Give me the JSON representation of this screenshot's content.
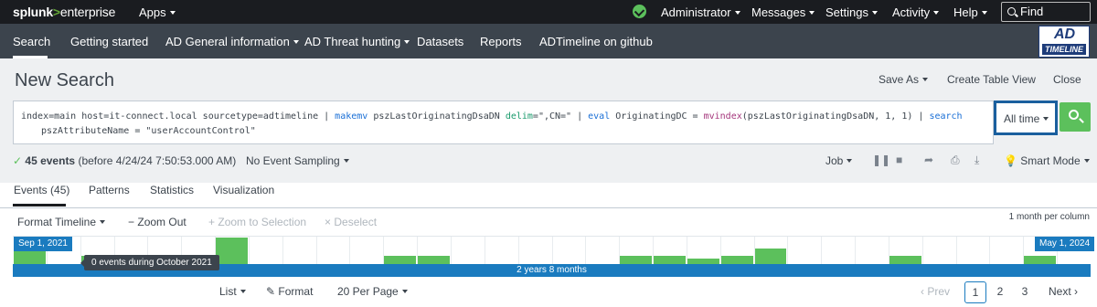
{
  "top_bar": {
    "logo": {
      "brand": "splunk",
      "arrow": ">",
      "product": "enterprise"
    },
    "apps_label": "Apps",
    "user_label": "Administrator",
    "messages_label": "Messages",
    "settings_label": "Settings",
    "activity_label": "Activity",
    "help_label": "Help",
    "find_placeholder": "Find"
  },
  "app_bar": {
    "nav_items": [
      "Search",
      "Getting started",
      "AD General information",
      "AD Threat hunting",
      "Datasets",
      "Reports",
      "ADTimeline on github"
    ],
    "logo": {
      "top": "AD",
      "bottom": "TIMELINE"
    }
  },
  "search": {
    "title": "New Search",
    "actions": {
      "save_as": "Save As",
      "create_table_view": "Create Table View",
      "close": "Close"
    },
    "query": {
      "line1": [
        {
          "t": "index=main host=it-connect.local sourcetype=adtimeline | ",
          "c": "text"
        },
        {
          "t": "makemv",
          "c": "kw"
        },
        {
          "t": " pszLastOriginatingDsaDN ",
          "c": "text"
        },
        {
          "t": "delim",
          "c": "arg"
        },
        {
          "t": "=\",CN=\" | ",
          "c": "text"
        },
        {
          "t": "eval",
          "c": "kw"
        },
        {
          "t": " OriginatingDC = ",
          "c": "text"
        },
        {
          "t": "mvindex",
          "c": "fn"
        },
        {
          "t": "(pszLastOriginatingDsaDN, 1, 1) |  ",
          "c": "text"
        },
        {
          "t": "search",
          "c": "kw"
        }
      ],
      "line2": "pszAttributeName = \"userAccountControl\""
    },
    "time_range": "All time",
    "events_count": "45 events",
    "events_before": "(before 4/24/24 7:50:53.000 AM)",
    "sampling": "No Event Sampling",
    "job_label": "Job",
    "mode": "Smart Mode"
  },
  "tabs": [
    "Events (45)",
    "Patterns",
    "Statistics",
    "Visualization"
  ],
  "timeline": {
    "format_label": "Format Timeline",
    "zoom_out": "Zoom Out",
    "zoom_selection": "Zoom to Selection",
    "deselect": "Deselect",
    "scale": "1 month per column",
    "start_label": "Sep 1, 2021",
    "end_label": "May 1, 2024",
    "span_label": "2 years 8 months",
    "tooltip": "0 events during October 2021",
    "columns": 32,
    "bars": [
      {
        "col": 0,
        "h": 0.55
      },
      {
        "col": 2,
        "h": 0.3
      },
      {
        "col": 3,
        "h": 0.3
      },
      {
        "col": 6,
        "h": 0.95
      },
      {
        "col": 11,
        "h": 0.3
      },
      {
        "col": 12,
        "h": 0.3
      },
      {
        "col": 18,
        "h": 0.3
      },
      {
        "col": 19,
        "h": 0.3
      },
      {
        "col": 20,
        "h": 0.2
      },
      {
        "col": 21,
        "h": 0.3
      },
      {
        "col": 22,
        "h": 0.55
      },
      {
        "col": 26,
        "h": 0.3
      },
      {
        "col": 30,
        "h": 0.3
      }
    ]
  },
  "results": {
    "list_label": "List",
    "format_label": "Format",
    "per_page": "20 Per Page",
    "prev": "Prev",
    "pages": [
      "1",
      "2",
      "3"
    ],
    "next": "Next"
  }
}
